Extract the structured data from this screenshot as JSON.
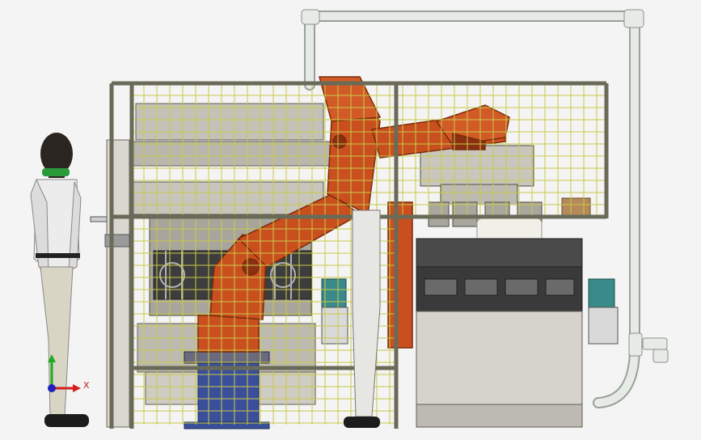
{
  "viewport": {
    "background": "#f4f4f4"
  },
  "triad": {
    "x_label": "X",
    "x_color": "#d42020",
    "y_color": "#22aa22",
    "z_color": "#2020c0",
    "icon": "coordinate-triad-icon"
  },
  "scene": {
    "colors": {
      "frame": "#7a7a68",
      "guard_mesh": "#c9c94a",
      "robot": "#c9501e",
      "robot_dark": "#8a3010",
      "pedestal": "#3a4f9a",
      "machine_gray": "#b8b6b0",
      "machine_dark": "#3a3a3a",
      "pipe": "#e8ece8",
      "motor": "#3a8a8a",
      "person_suit": "#ececec",
      "person_skin": "#2a2520"
    },
    "objects": [
      {
        "name": "human-figure-left",
        "icon": "person-icon"
      },
      {
        "name": "human-figure-center",
        "icon": "person-icon"
      },
      {
        "name": "industrial-robot-arm",
        "icon": "robot-arm-icon"
      },
      {
        "name": "robot-pedestal",
        "icon": "pedestal-icon"
      },
      {
        "name": "safety-fence",
        "icon": "fence-icon"
      },
      {
        "name": "left-machine-assembly",
        "icon": "machine-icon"
      },
      {
        "name": "right-machine-assembly",
        "icon": "machine-icon"
      },
      {
        "name": "overhead-pipe",
        "icon": "pipe-icon"
      },
      {
        "name": "gripper-head",
        "icon": "gripper-icon"
      },
      {
        "name": "motor-unit",
        "icon": "motor-icon"
      }
    ]
  }
}
